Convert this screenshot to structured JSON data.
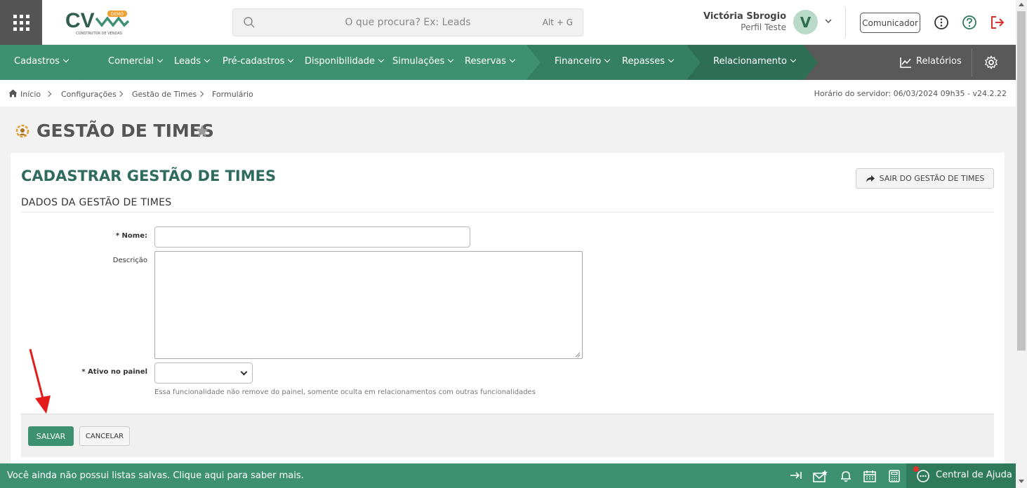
{
  "logo": {
    "text": "CV",
    "badge": "DEMO",
    "tagline": "CONSTRUTOR DE VENDAS"
  },
  "search": {
    "placeholder": "O que procura? Ex: Leads",
    "shortcut": "Alt + G"
  },
  "user": {
    "name": "Victória Sbrogio",
    "profile": "Perfil Teste",
    "initial": "V"
  },
  "header": {
    "comunicador": "Comunicador"
  },
  "nav": {
    "items": [
      {
        "label": "Cadastros"
      },
      {
        "label": "Comercial"
      },
      {
        "label": "Leads"
      },
      {
        "label": "Pré-cadastros"
      },
      {
        "label": "Disponibilidade"
      },
      {
        "label": "Simulações"
      },
      {
        "label": "Reservas"
      },
      {
        "label": "Financeiro"
      },
      {
        "label": "Repasses"
      },
      {
        "label": "Relacionamento"
      }
    ],
    "reports": "Relatórios",
    "colors": {
      "light_green": "#3d9170",
      "mid_green": "#357f63",
      "dark_green": "#2e6e56",
      "grey": "#595959"
    }
  },
  "breadcrumb": {
    "items": [
      "Início",
      "Configurações",
      "Gestão de Times",
      "Formulário"
    ],
    "server_time": "Horário do servidor: 06/03/2024 09h35 - v24.2.22"
  },
  "page": {
    "title": "GESTÃO DE TIMES"
  },
  "form": {
    "title": "CADASTRAR GESTÃO DE TIMES",
    "exit_button": "SAIR DO GESTÃO DE TIMES",
    "section": "DADOS DA GESTÃO DE TIMES",
    "fields": {
      "nome_label": "Nome:",
      "nome_value": "",
      "descricao_label": "Descrição",
      "descricao_value": "",
      "ativo_label": "Ativo no painel",
      "ativo_value": "",
      "ativo_help": "Essa funcionalidade não remove do painel, somente oculta em relacionamentos com outras funcionalidades"
    },
    "save": "SALVAR",
    "cancel": "CANCELAR"
  },
  "bottom": {
    "message": "Você ainda não possui listas salvas. Clique aqui para saber mais.",
    "help": "Central de Ajuda"
  }
}
